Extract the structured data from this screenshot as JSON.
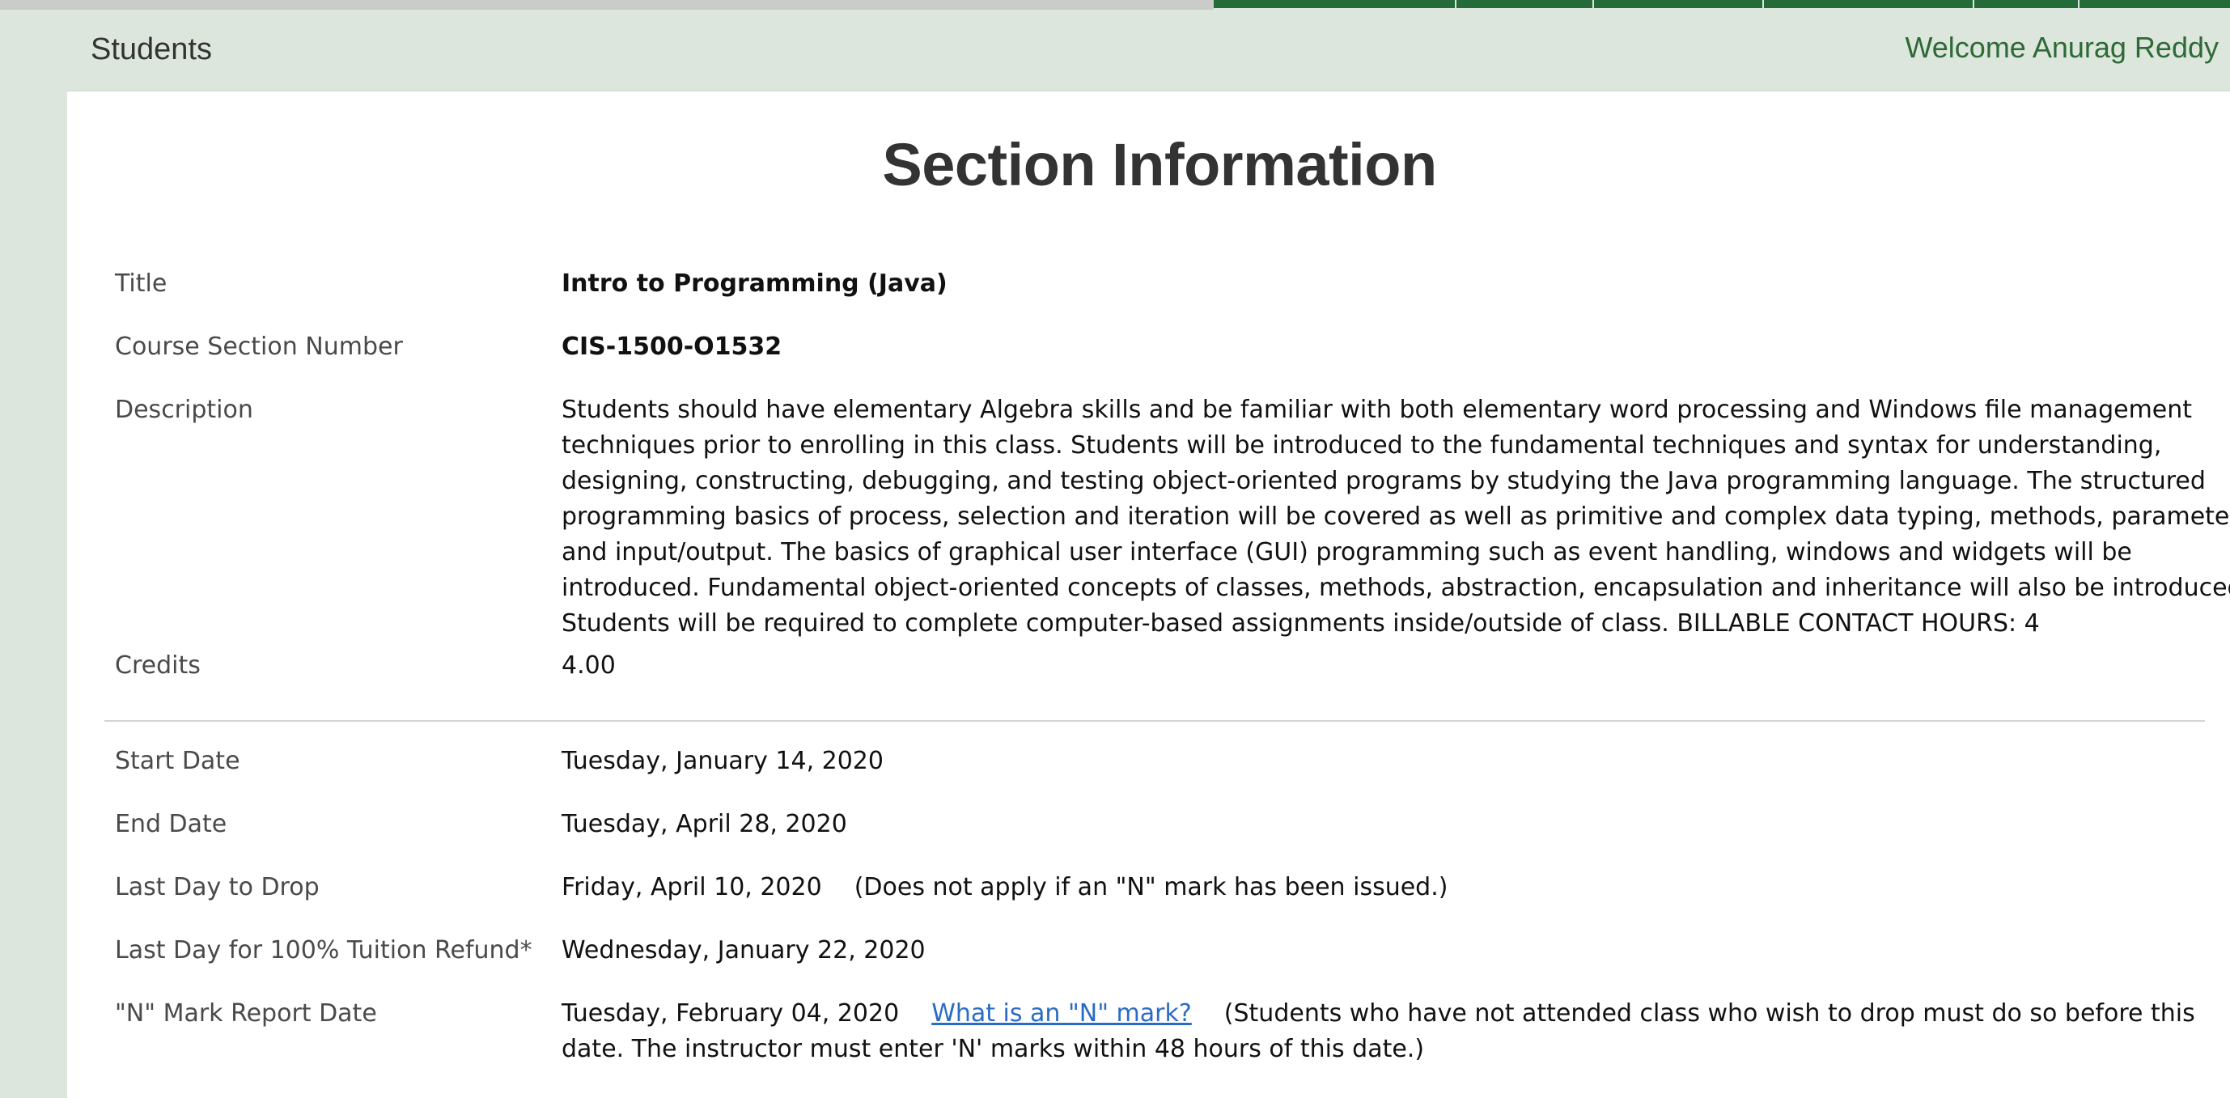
{
  "header": {
    "app_title": "Students",
    "welcome_text": "Welcome Anurag Reddy"
  },
  "page": {
    "title": "Section Information"
  },
  "section": {
    "title_label": "Title",
    "title_value": "Intro to Programming (Java)",
    "number_label": "Course Section Number",
    "number_value": "CIS-1500-O1532",
    "description_label": "Description",
    "description_value": "Students should have elementary Algebra skills and be familiar with both elementary word processing and Windows file management techniques prior to enrolling in this class. Students will be introduced to the fundamental techniques and syntax for understanding, designing, constructing, debugging, and testing object-oriented programs by studying the Java programming language. The structured programming basics of process, selection and iteration will be covered as well as primitive and complex data typing, methods, parameters and input/output. The basics of graphical user interface (GUI) programming such as event handling, windows and widgets will be introduced. Fundamental object-oriented concepts of classes, methods, abstraction, encapsulation and inheritance will also be introduced. Students will be required to complete computer-based assignments inside/outside of class. BILLABLE CONTACT HOURS: 4",
    "credits_label": "Credits",
    "credits_value": "4.00"
  },
  "dates": {
    "start_label": "Start Date",
    "start_value": "Tuesday, January 14, 2020",
    "end_label": "End Date",
    "end_value": "Tuesday, April 28, 2020",
    "drop_label": "Last Day to Drop",
    "drop_value": "Friday, April 10, 2020",
    "drop_note": "(Does not apply if an \"N\" mark has been issued.)",
    "refund_label": "Last Day for 100% Tuition Refund*",
    "refund_value": "Wednesday, January 22, 2020",
    "nmark_label": "\"N\" Mark Report Date",
    "nmark_value": "Tuesday, February 04, 2020",
    "nmark_link": "What is an \"N\" mark?",
    "nmark_note": "(Students who have not attended class who wish to drop must do so before this date. The instructor must enter 'N' marks within 48 hours of this date.)"
  },
  "colors": {
    "accent_green": "#256b3a",
    "link_blue": "#2a6cc4",
    "background": "#dde6dd"
  }
}
